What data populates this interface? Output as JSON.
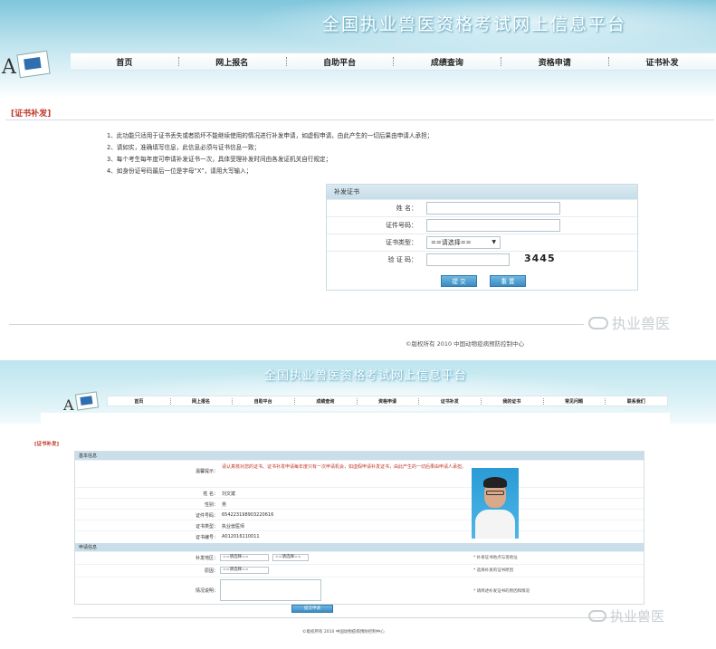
{
  "top": {
    "site_title": "全国执业兽医资格考试网上信息平台",
    "nav": [
      "首页",
      "网上报名",
      "自助平台",
      "成绩查询",
      "资格申请",
      "证书补发"
    ],
    "section_title": "[证书补发]",
    "notes": [
      "1、此功能只适用于证书丢失或者损坏不能继续使用的情况进行补发申请，如虚假申请，由此产生的一切后果由申请人承担；",
      "2、请如实，准确填写信息，此信息必须与证书信息一致；",
      "3、每个考生每年度可申请补发证书一次，具体受理补发时间由各发证机关自行规定；",
      "4、如身份证号码最后一位是字母“X”，请用大写输入；"
    ],
    "form": {
      "header": "补发证书",
      "name_label": "姓    名：",
      "idcard_label": "证件号码：",
      "cert_type_label": "证书类型：",
      "cert_type_value": "==请选择==",
      "captcha_label": "验 证 码：",
      "captcha_value": "3445",
      "submit_label": "提 交",
      "reset_label": "重 置"
    },
    "watermark": "执业兽医",
    "copyright": "©版权所有 2010 中国动物疫病预防控制中心"
  },
  "bottom": {
    "site_title": "全国执业兽医资格考试网上信息平台",
    "nav": [
      "首页",
      "网上报名",
      "自助平台",
      "成绩查询",
      "资格申请",
      "证书补发",
      "我的证书",
      "常见问题",
      "联系我们"
    ],
    "section_title": "[证书补发]",
    "basic_header": "基本信息",
    "warning_label": "温馨提示：",
    "warning_text": "请认真核对您的证书。证书补发申请每年度只有一次申请机会，如虚假申请补发证书，由此产生的一切后果由申请人承担。",
    "fields": [
      {
        "label": "姓  名：",
        "value": "刘文斌"
      },
      {
        "label": "性别：",
        "value": "男"
      },
      {
        "label": "证件号码：",
        "value": "654223198903220616"
      },
      {
        "label": "证书类型：",
        "value": "执业兽医师"
      },
      {
        "label": "证书编号：",
        "value": "A012016110011"
      }
    ],
    "apply_header": "申请信息",
    "area_label": "补发地区：",
    "area_select_1": "==请选择==",
    "area_select_2": "==请选择==",
    "reason_label": "原因：",
    "reason_select": "==请选择==",
    "note_label": "情况说明：",
    "right_note_1": "* 补发证书地点与现地址",
    "right_note_2": "* 选择补发的证书原因",
    "right_note_3": "* 请简述补发证书的原因和情况",
    "submit_label": "提交申请",
    "watermark": "执业兽医",
    "copyright": "©版权所有 2010 中国动物疫病预防控制中心"
  }
}
